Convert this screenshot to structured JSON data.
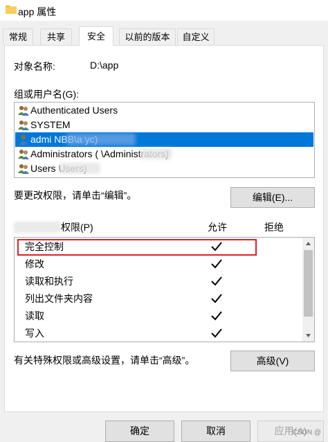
{
  "window": {
    "title": "app 属性"
  },
  "tabs": [
    {
      "label": "常规"
    },
    {
      "label": "共享"
    },
    {
      "label": "安全"
    },
    {
      "label": "以前的版本"
    },
    {
      "label": "自定义"
    }
  ],
  "object": {
    "label": "对象名称:",
    "value": "D:\\app"
  },
  "groups": {
    "label": "组或用户名(G):",
    "items": [
      {
        "name": "Authenticated Users",
        "selected": false
      },
      {
        "name": "SYSTEM",
        "selected": false
      },
      {
        "name": "admi          NBB\\a        yc)",
        "selected": true
      },
      {
        "name": "Administrators (        \\Administrators)",
        "selected": false
      },
      {
        "name": "Users           Users)",
        "selected": false
      }
    ]
  },
  "edit": {
    "hint": "要更改权限，请单击“编辑”。",
    "button": "编辑(E)..."
  },
  "permissions": {
    "header": "权限(P)",
    "allow": "允许",
    "deny": "拒绝",
    "items": [
      {
        "name": "完全控制",
        "allow": true,
        "deny": false
      },
      {
        "name": "修改",
        "allow": true,
        "deny": false
      },
      {
        "name": "读取和执行",
        "allow": true,
        "deny": false
      },
      {
        "name": "列出文件夹内容",
        "allow": true,
        "deny": false
      },
      {
        "name": "读取",
        "allow": true,
        "deny": false
      },
      {
        "name": "写入",
        "allow": true,
        "deny": false
      }
    ]
  },
  "advanced": {
    "hint": "有关特殊权限或高级设置，请单击“高级”。",
    "button": "高级(V)"
  },
  "footer": {
    "ok": "确定",
    "cancel": "取消",
    "apply": "应用(A)"
  },
  "watermark": "CSDN @"
}
